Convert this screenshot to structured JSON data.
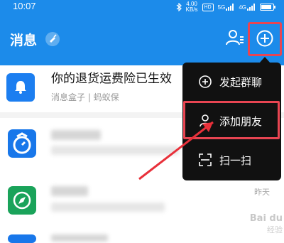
{
  "status_bar": {
    "time": "10:07",
    "net_speed_value": "4.00",
    "net_speed_unit": "KB/s",
    "hd_label": "HD",
    "signal_1": "5G",
    "signal_2": "4G"
  },
  "header": {
    "title": "消息",
    "brand_color": "#1c8bea"
  },
  "notification": {
    "title": "你的退货运费险已生效",
    "subtitle": "消息盒子 | 蚂蚁保",
    "icon_color": "#1c7ef0"
  },
  "rows": [
    {
      "icon": "alarm-clock-icon",
      "icon_color": "#1877ea",
      "time": ""
    },
    {
      "icon": "compass-icon",
      "icon_color": "#1aa35a",
      "time": "昨天"
    }
  ],
  "popup_menu": {
    "items": [
      {
        "icon": "add-circle-icon",
        "label": "发起群聊"
      },
      {
        "icon": "person-icon",
        "label": "添加朋友"
      },
      {
        "icon": "scan-icon",
        "label": "扫一扫"
      }
    ]
  },
  "watermark": {
    "brand": "Bai du",
    "text": "经验"
  },
  "highlight_color": "#e84552"
}
